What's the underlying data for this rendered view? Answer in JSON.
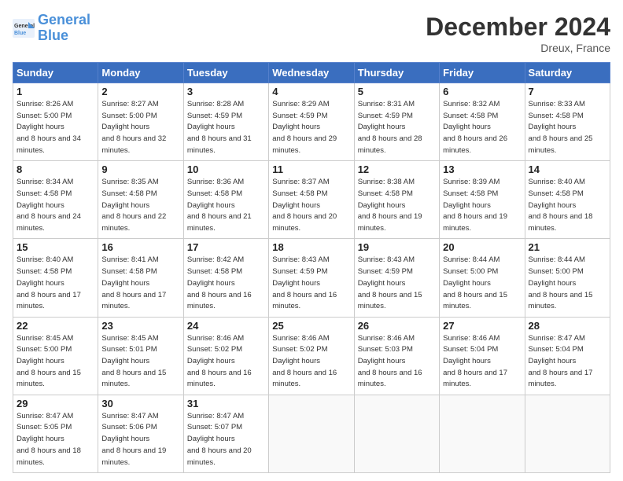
{
  "logo": {
    "line1": "General",
    "line2": "Blue"
  },
  "header": {
    "month": "December 2024",
    "location": "Dreux, France"
  },
  "weekdays": [
    "Sunday",
    "Monday",
    "Tuesday",
    "Wednesday",
    "Thursday",
    "Friday",
    "Saturday"
  ],
  "weeks": [
    [
      {
        "day": "1",
        "sunrise": "8:26 AM",
        "sunset": "5:00 PM",
        "daylight": "8 hours and 34 minutes."
      },
      {
        "day": "2",
        "sunrise": "8:27 AM",
        "sunset": "5:00 PM",
        "daylight": "8 hours and 32 minutes."
      },
      {
        "day": "3",
        "sunrise": "8:28 AM",
        "sunset": "4:59 PM",
        "daylight": "8 hours and 31 minutes."
      },
      {
        "day": "4",
        "sunrise": "8:29 AM",
        "sunset": "4:59 PM",
        "daylight": "8 hours and 29 minutes."
      },
      {
        "day": "5",
        "sunrise": "8:31 AM",
        "sunset": "4:59 PM",
        "daylight": "8 hours and 28 minutes."
      },
      {
        "day": "6",
        "sunrise": "8:32 AM",
        "sunset": "4:58 PM",
        "daylight": "8 hours and 26 minutes."
      },
      {
        "day": "7",
        "sunrise": "8:33 AM",
        "sunset": "4:58 PM",
        "daylight": "8 hours and 25 minutes."
      }
    ],
    [
      {
        "day": "8",
        "sunrise": "8:34 AM",
        "sunset": "4:58 PM",
        "daylight": "8 hours and 24 minutes."
      },
      {
        "day": "9",
        "sunrise": "8:35 AM",
        "sunset": "4:58 PM",
        "daylight": "8 hours and 22 minutes."
      },
      {
        "day": "10",
        "sunrise": "8:36 AM",
        "sunset": "4:58 PM",
        "daylight": "8 hours and 21 minutes."
      },
      {
        "day": "11",
        "sunrise": "8:37 AM",
        "sunset": "4:58 PM",
        "daylight": "8 hours and 20 minutes."
      },
      {
        "day": "12",
        "sunrise": "8:38 AM",
        "sunset": "4:58 PM",
        "daylight": "8 hours and 19 minutes."
      },
      {
        "day": "13",
        "sunrise": "8:39 AM",
        "sunset": "4:58 PM",
        "daylight": "8 hours and 19 minutes."
      },
      {
        "day": "14",
        "sunrise": "8:40 AM",
        "sunset": "4:58 PM",
        "daylight": "8 hours and 18 minutes."
      }
    ],
    [
      {
        "day": "15",
        "sunrise": "8:40 AM",
        "sunset": "4:58 PM",
        "daylight": "8 hours and 17 minutes."
      },
      {
        "day": "16",
        "sunrise": "8:41 AM",
        "sunset": "4:58 PM",
        "daylight": "8 hours and 17 minutes."
      },
      {
        "day": "17",
        "sunrise": "8:42 AM",
        "sunset": "4:58 PM",
        "daylight": "8 hours and 16 minutes."
      },
      {
        "day": "18",
        "sunrise": "8:43 AM",
        "sunset": "4:59 PM",
        "daylight": "8 hours and 16 minutes."
      },
      {
        "day": "19",
        "sunrise": "8:43 AM",
        "sunset": "4:59 PM",
        "daylight": "8 hours and 15 minutes."
      },
      {
        "day": "20",
        "sunrise": "8:44 AM",
        "sunset": "5:00 PM",
        "daylight": "8 hours and 15 minutes."
      },
      {
        "day": "21",
        "sunrise": "8:44 AM",
        "sunset": "5:00 PM",
        "daylight": "8 hours and 15 minutes."
      }
    ],
    [
      {
        "day": "22",
        "sunrise": "8:45 AM",
        "sunset": "5:00 PM",
        "daylight": "8 hours and 15 minutes."
      },
      {
        "day": "23",
        "sunrise": "8:45 AM",
        "sunset": "5:01 PM",
        "daylight": "8 hours and 15 minutes."
      },
      {
        "day": "24",
        "sunrise": "8:46 AM",
        "sunset": "5:02 PM",
        "daylight": "8 hours and 16 minutes."
      },
      {
        "day": "25",
        "sunrise": "8:46 AM",
        "sunset": "5:02 PM",
        "daylight": "8 hours and 16 minutes."
      },
      {
        "day": "26",
        "sunrise": "8:46 AM",
        "sunset": "5:03 PM",
        "daylight": "8 hours and 16 minutes."
      },
      {
        "day": "27",
        "sunrise": "8:46 AM",
        "sunset": "5:04 PM",
        "daylight": "8 hours and 17 minutes."
      },
      {
        "day": "28",
        "sunrise": "8:47 AM",
        "sunset": "5:04 PM",
        "daylight": "8 hours and 17 minutes."
      }
    ],
    [
      {
        "day": "29",
        "sunrise": "8:47 AM",
        "sunset": "5:05 PM",
        "daylight": "8 hours and 18 minutes."
      },
      {
        "day": "30",
        "sunrise": "8:47 AM",
        "sunset": "5:06 PM",
        "daylight": "8 hours and 19 minutes."
      },
      {
        "day": "31",
        "sunrise": "8:47 AM",
        "sunset": "5:07 PM",
        "daylight": "8 hours and 20 minutes."
      },
      null,
      null,
      null,
      null
    ]
  ]
}
